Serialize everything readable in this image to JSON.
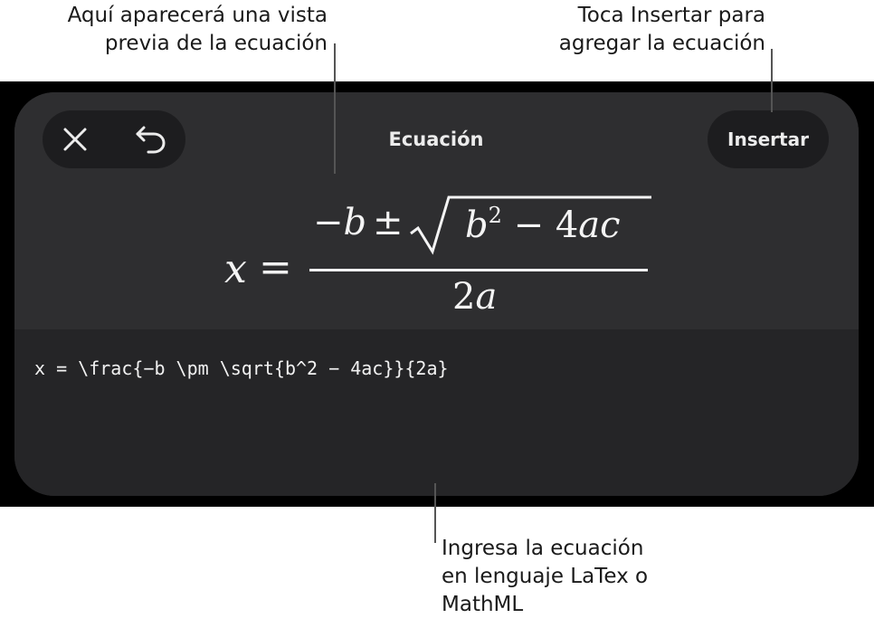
{
  "callouts": {
    "preview": [
      "Aquí aparecerá una vista",
      "previa de la ecuación"
    ],
    "insert": [
      "Toca Insertar para",
      "agregar la ecuación"
    ],
    "input": [
      "Ingresa la ecuación",
      "en lenguaje LaTex o",
      "MathML"
    ]
  },
  "toolbar": {
    "close_icon": "close-icon",
    "undo_icon": "undo-icon",
    "title": "Ecuación",
    "insert_label": "Insertar"
  },
  "preview": {
    "lhs": "x",
    "equals": "=",
    "numerator_minus": "−",
    "numerator_b": "b",
    "plus_minus": "±",
    "radicand_b": "b",
    "radicand_exp": "2",
    "radicand_rest": " − 4",
    "radicand_ac": "ac",
    "denominator_coef": "2",
    "denominator_var": "a"
  },
  "editor": {
    "latex": "x = \\frac{−b \\pm \\sqrt{b^2 − 4ac}}{2a}"
  },
  "colors": {
    "sheet_background": "#2e2e30",
    "editor_background": "#252527",
    "button_background": "#1d1d1f",
    "text": "#ececec"
  }
}
